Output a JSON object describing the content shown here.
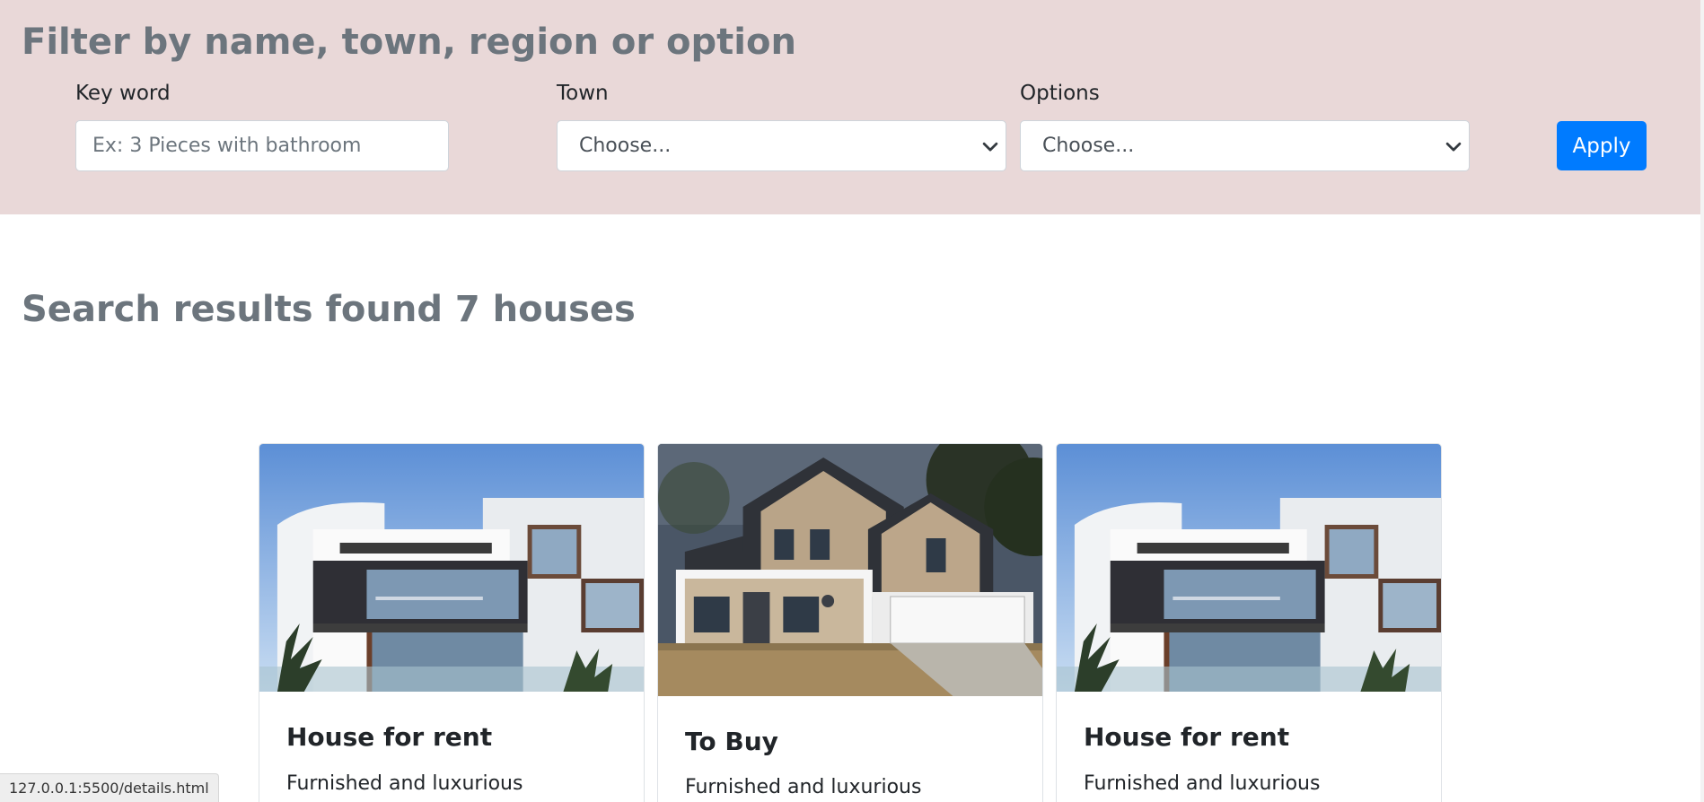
{
  "filter": {
    "title": "Filter by name, town, region or option",
    "keyword_label": "Key word",
    "keyword_placeholder": "Ex: 3 Pieces with bathroom",
    "keyword_value": "",
    "town_label": "Town",
    "town_selected": "Choose...",
    "options_label": "Options",
    "options_selected": "Choose...",
    "apply_label": "Apply"
  },
  "results": {
    "heading": "Search results found 7 houses"
  },
  "cards": [
    {
      "title": "House for rent",
      "text": "Furnished and luxurious",
      "image_icon": "modern-house-image"
    },
    {
      "title": "To Buy",
      "text": "Furnished and luxurious",
      "image_icon": "suburban-house-image"
    },
    {
      "title": "House for rent",
      "text": "Furnished and luxurious",
      "image_icon": "modern-house-image"
    }
  ],
  "status_bar": {
    "url": "127.0.0.1:5500/details.html"
  },
  "colors": {
    "filter_background": "#e9d8d8",
    "heading_gray": "#6c757d",
    "primary_button": "#007bff"
  }
}
